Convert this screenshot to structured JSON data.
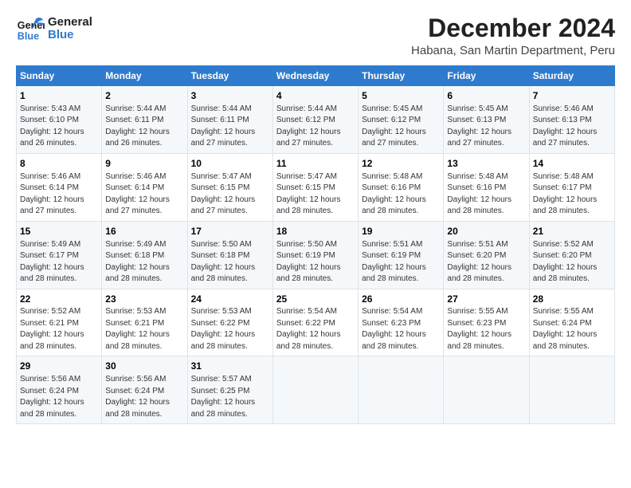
{
  "logo": {
    "line1": "General",
    "line2": "Blue"
  },
  "title": "December 2024",
  "subtitle": "Habana, San Martin Department, Peru",
  "days_of_week": [
    "Sunday",
    "Monday",
    "Tuesday",
    "Wednesday",
    "Thursday",
    "Friday",
    "Saturday"
  ],
  "weeks": [
    [
      {
        "day": "1",
        "info": "Sunrise: 5:43 AM\nSunset: 6:10 PM\nDaylight: 12 hours\nand 26 minutes."
      },
      {
        "day": "2",
        "info": "Sunrise: 5:44 AM\nSunset: 6:11 PM\nDaylight: 12 hours\nand 26 minutes."
      },
      {
        "day": "3",
        "info": "Sunrise: 5:44 AM\nSunset: 6:11 PM\nDaylight: 12 hours\nand 27 minutes."
      },
      {
        "day": "4",
        "info": "Sunrise: 5:44 AM\nSunset: 6:12 PM\nDaylight: 12 hours\nand 27 minutes."
      },
      {
        "day": "5",
        "info": "Sunrise: 5:45 AM\nSunset: 6:12 PM\nDaylight: 12 hours\nand 27 minutes."
      },
      {
        "day": "6",
        "info": "Sunrise: 5:45 AM\nSunset: 6:13 PM\nDaylight: 12 hours\nand 27 minutes."
      },
      {
        "day": "7",
        "info": "Sunrise: 5:46 AM\nSunset: 6:13 PM\nDaylight: 12 hours\nand 27 minutes."
      }
    ],
    [
      {
        "day": "8",
        "info": "Sunrise: 5:46 AM\nSunset: 6:14 PM\nDaylight: 12 hours\nand 27 minutes."
      },
      {
        "day": "9",
        "info": "Sunrise: 5:46 AM\nSunset: 6:14 PM\nDaylight: 12 hours\nand 27 minutes."
      },
      {
        "day": "10",
        "info": "Sunrise: 5:47 AM\nSunset: 6:15 PM\nDaylight: 12 hours\nand 27 minutes."
      },
      {
        "day": "11",
        "info": "Sunrise: 5:47 AM\nSunset: 6:15 PM\nDaylight: 12 hours\nand 28 minutes."
      },
      {
        "day": "12",
        "info": "Sunrise: 5:48 AM\nSunset: 6:16 PM\nDaylight: 12 hours\nand 28 minutes."
      },
      {
        "day": "13",
        "info": "Sunrise: 5:48 AM\nSunset: 6:16 PM\nDaylight: 12 hours\nand 28 minutes."
      },
      {
        "day": "14",
        "info": "Sunrise: 5:48 AM\nSunset: 6:17 PM\nDaylight: 12 hours\nand 28 minutes."
      }
    ],
    [
      {
        "day": "15",
        "info": "Sunrise: 5:49 AM\nSunset: 6:17 PM\nDaylight: 12 hours\nand 28 minutes."
      },
      {
        "day": "16",
        "info": "Sunrise: 5:49 AM\nSunset: 6:18 PM\nDaylight: 12 hours\nand 28 minutes."
      },
      {
        "day": "17",
        "info": "Sunrise: 5:50 AM\nSunset: 6:18 PM\nDaylight: 12 hours\nand 28 minutes."
      },
      {
        "day": "18",
        "info": "Sunrise: 5:50 AM\nSunset: 6:19 PM\nDaylight: 12 hours\nand 28 minutes."
      },
      {
        "day": "19",
        "info": "Sunrise: 5:51 AM\nSunset: 6:19 PM\nDaylight: 12 hours\nand 28 minutes."
      },
      {
        "day": "20",
        "info": "Sunrise: 5:51 AM\nSunset: 6:20 PM\nDaylight: 12 hours\nand 28 minutes."
      },
      {
        "day": "21",
        "info": "Sunrise: 5:52 AM\nSunset: 6:20 PM\nDaylight: 12 hours\nand 28 minutes."
      }
    ],
    [
      {
        "day": "22",
        "info": "Sunrise: 5:52 AM\nSunset: 6:21 PM\nDaylight: 12 hours\nand 28 minutes."
      },
      {
        "day": "23",
        "info": "Sunrise: 5:53 AM\nSunset: 6:21 PM\nDaylight: 12 hours\nand 28 minutes."
      },
      {
        "day": "24",
        "info": "Sunrise: 5:53 AM\nSunset: 6:22 PM\nDaylight: 12 hours\nand 28 minutes."
      },
      {
        "day": "25",
        "info": "Sunrise: 5:54 AM\nSunset: 6:22 PM\nDaylight: 12 hours\nand 28 minutes."
      },
      {
        "day": "26",
        "info": "Sunrise: 5:54 AM\nSunset: 6:23 PM\nDaylight: 12 hours\nand 28 minutes."
      },
      {
        "day": "27",
        "info": "Sunrise: 5:55 AM\nSunset: 6:23 PM\nDaylight: 12 hours\nand 28 minutes."
      },
      {
        "day": "28",
        "info": "Sunrise: 5:55 AM\nSunset: 6:24 PM\nDaylight: 12 hours\nand 28 minutes."
      }
    ],
    [
      {
        "day": "29",
        "info": "Sunrise: 5:56 AM\nSunset: 6:24 PM\nDaylight: 12 hours\nand 28 minutes."
      },
      {
        "day": "30",
        "info": "Sunrise: 5:56 AM\nSunset: 6:24 PM\nDaylight: 12 hours\nand 28 minutes."
      },
      {
        "day": "31",
        "info": "Sunrise: 5:57 AM\nSunset: 6:25 PM\nDaylight: 12 hours\nand 28 minutes."
      },
      null,
      null,
      null,
      null
    ]
  ]
}
